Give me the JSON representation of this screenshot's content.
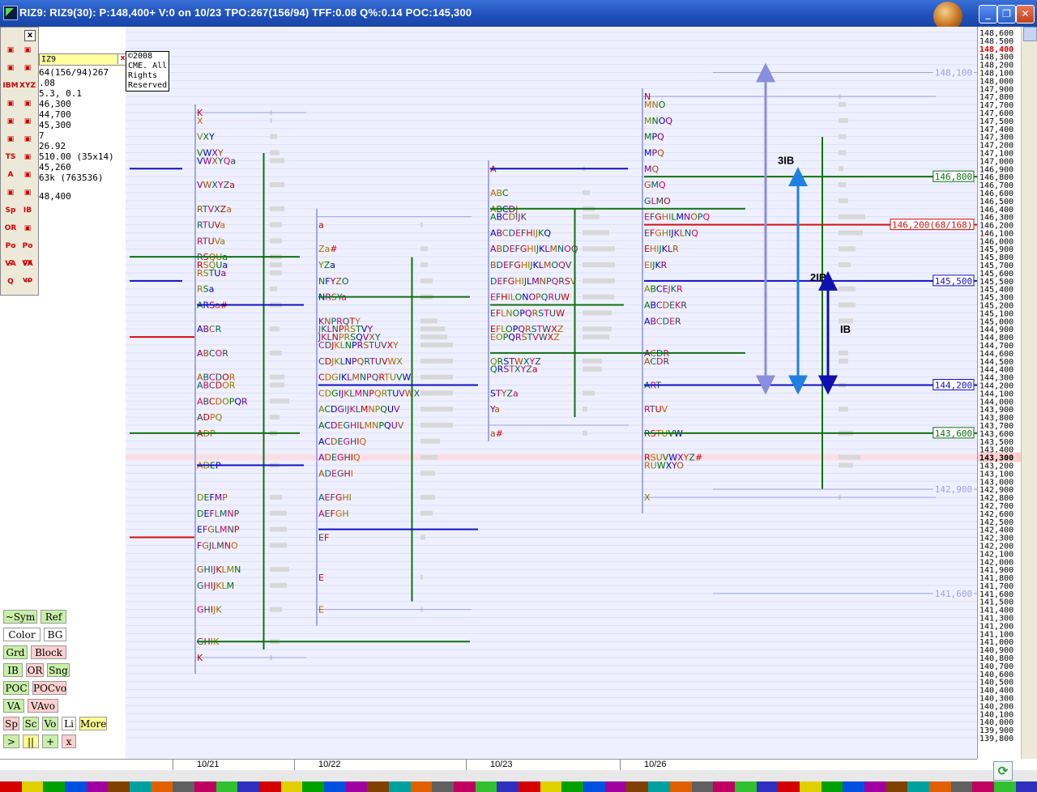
{
  "window": {
    "title": "RIZ9: RIZ9(30): P:148,400+ V:0 on 10/23 TPO:267(156/94) TFF:0.08 Q%:0.14 POC:145,300",
    "controls": {
      "minimize": "_",
      "restore": "❐",
      "close": "✕"
    }
  },
  "copyright": "©2008 CME. All Rights Reserved",
  "symbol": {
    "name": "IZ9",
    "close": "x"
  },
  "info_rows": [
    "64(156/94)267",
    ".08",
    "5.3, 0.1",
    "46,300",
    "44,700",
    "45,300",
    "7",
    "26.92",
    "510.00 (35x14)",
    "45,260",
    "63k (763536)",
    "48,400"
  ],
  "tools": [
    {
      "icon": "pencil-edit-icon",
      "label": ""
    },
    {
      "icon": "chart-edit-icon",
      "label": ""
    },
    {
      "icon": "hand-icon",
      "label": ""
    },
    {
      "icon": "refresh-icon",
      "label": ""
    },
    {
      "icon": "ibm-check-icon",
      "label": "IBM"
    },
    {
      "icon": "xyz-triangle-icon",
      "label": "XYZ"
    },
    {
      "icon": "camera-icon",
      "label": ""
    },
    {
      "icon": "calculator-icon",
      "label": ""
    },
    {
      "icon": "color-wheel-icon",
      "label": ""
    },
    {
      "icon": "color-wheel-2-icon",
      "label": ""
    },
    {
      "icon": "grid-icon",
      "label": ""
    },
    {
      "icon": "play-icon",
      "label": ""
    },
    {
      "icon": "ts-icon",
      "label": "TS"
    },
    {
      "icon": "line-icon",
      "label": ""
    },
    {
      "icon": "text-a-icon",
      "label": "A"
    },
    {
      "icon": "text-lines-icon",
      "label": ""
    },
    {
      "icon": "ruler-icon",
      "label": ""
    },
    {
      "icon": "scale-icon",
      "label": ""
    },
    {
      "icon": "sp-icon",
      "label": "Sp"
    },
    {
      "icon": "ib-icon",
      "label": "IB"
    },
    {
      "icon": "or-icon",
      "label": "OR"
    },
    {
      "icon": "diamond-icon",
      "label": ""
    },
    {
      "icon": "poc-icon",
      "label": "Po c"
    },
    {
      "icon": "pocv-icon",
      "label": "Po cv"
    },
    {
      "icon": "va-icon",
      "label": "VA"
    },
    {
      "icon": "vavo-icon",
      "label": "VA vo"
    },
    {
      "icon": "zoom-icon",
      "label": "Q"
    },
    {
      "icon": "move-arrows-icon",
      "label": "↔"
    }
  ],
  "buttons": [
    {
      "label": "~Sym",
      "color": "#c8f0a8"
    },
    {
      "label": "Ref",
      "color": "#c8f0a8"
    },
    {
      "label": "Color",
      "color": "#ffffff"
    },
    {
      "label": "BG",
      "color": "#ffffff"
    },
    {
      "label": "Grd",
      "color": "#c8f0a8"
    },
    {
      "label": "Block",
      "color": "#ffd0d0"
    },
    {
      "label": "IB",
      "color": "#c8f0a8"
    },
    {
      "label": "OR",
      "color": "#ffd0d0"
    },
    {
      "label": "Sng",
      "color": "#c8f0a8"
    },
    {
      "label": "POC",
      "color": "#c8f0a8"
    },
    {
      "label": "POCvo",
      "color": "#ffd0d0"
    },
    {
      "label": "VA",
      "color": "#c8f0a8"
    },
    {
      "label": "VAvo",
      "color": "#ffd0d0"
    },
    {
      "label": "Sp",
      "color": "#ffd0d0"
    },
    {
      "label": "Sc",
      "color": "#c8f0a8"
    },
    {
      "label": "Vo",
      "color": "#c8f0a8"
    },
    {
      "label": "Li",
      "color": "#ffffff"
    },
    {
      "label": "More",
      "color": "#ffff90"
    },
    {
      "label": ">",
      "color": "#c8f0a8"
    },
    {
      "label": "||",
      "color": "#ffff90"
    },
    {
      "label": "+",
      "color": "#c8f0a8"
    },
    {
      "label": "x",
      "color": "#ffd0d0"
    }
  ],
  "chart_data": {
    "type": "market_profile",
    "y_axis": {
      "min": 139800,
      "max": 148600,
      "step": 100,
      "label_values": [
        139800,
        139900,
        140000,
        140100,
        140200,
        140300,
        140400,
        140500,
        140600,
        140700,
        140800,
        140900,
        141000,
        141100,
        141200,
        141300,
        141400,
        141500,
        141600,
        141700,
        141800,
        141900,
        142000,
        142100,
        142200,
        142300,
        142400,
        142500,
        142600,
        142700,
        142800,
        142900,
        143000,
        143100,
        143200,
        143300,
        143400,
        143500,
        143600,
        143700,
        143800,
        143900,
        144000,
        144100,
        144200,
        144300,
        144400,
        144500,
        144600,
        144700,
        144800,
        144900,
        145000,
        145100,
        145200,
        145300,
        145400,
        145500,
        145600,
        145700,
        145800,
        145900,
        146000,
        146100,
        146200,
        146300,
        146400,
        146500,
        146600,
        146700,
        146800,
        146900,
        147000,
        147100,
        147200,
        147300,
        147400,
        147500,
        147600,
        147700,
        147800,
        147900,
        148000,
        148100,
        148200,
        148300,
        148400,
        148500,
        148600
      ]
    },
    "current_price": 148400,
    "highlight_price": 143300,
    "highlight_price_label": "143,300",
    "current_price_label": "148,400",
    "dates": [
      "10/21",
      "10/22",
      "10/23",
      "10/26"
    ],
    "sessions": [
      {
        "date": "10/21",
        "high": 147600,
        "low": 140800,
        "rows": [
          [
            "K",
            147600
          ],
          [
            "X",
            147500
          ],
          [
            "VXY",
            147300
          ],
          [
            "VWXY",
            147100
          ],
          [
            "VWXYQa",
            147000
          ],
          [
            "VWXYZa",
            146700
          ],
          [
            "RTVXZa",
            146400
          ],
          [
            "RTUVa",
            146200
          ],
          [
            "RTUVa",
            146000
          ],
          [
            "RSQUa",
            145800
          ],
          [
            "RSQUa",
            145700
          ],
          [
            "RSTUa",
            145600
          ],
          [
            "RSa",
            145400
          ],
          [
            "ARSa#",
            145200
          ],
          [
            "ABCR",
            144900
          ],
          [
            "ABCOR",
            144600
          ],
          [
            "ABCDOR",
            144300
          ],
          [
            "ABCDOR",
            144200
          ],
          [
            "ABCDOPQR",
            144000
          ],
          [
            "ADPQ",
            143800
          ],
          [
            "ADP",
            143600
          ],
          [
            "ADEP",
            143200
          ],
          [
            "DEFMP",
            142800
          ],
          [
            "DEFLMNP",
            142600
          ],
          [
            "EFGLMNP",
            142400
          ],
          [
            "FGJLMNO",
            142200
          ],
          [
            "GHIJKLMN",
            141900
          ],
          [
            "GHIJKLM",
            141700
          ],
          [
            "GHIJK",
            141400
          ],
          [
            "GHIK",
            141000
          ],
          [
            "K",
            140800
          ]
        ]
      },
      {
        "date": "10/22",
        "high": 146300,
        "low": 141400,
        "rows": [
          [
            "a",
            146200
          ],
          [
            "Za#",
            145900
          ],
          [
            "YZa",
            145700
          ],
          [
            "NFYZO",
            145500
          ],
          [
            "NRSYa",
            145300
          ],
          [
            "KNPRQTY",
            145000
          ],
          [
            "JKLNPRSTVY",
            144900
          ],
          [
            "JKLNPRSQVXY",
            144800
          ],
          [
            "CDJKLNPRSTUVXY",
            144700
          ],
          [
            "CDJKLNPQRTUVWX",
            144500
          ],
          [
            "CDGIKLMNPQRTUVW",
            144300
          ],
          [
            "CDGIJKLMNPQRTUVWX",
            144100
          ],
          [
            "ACDGIJKLMNPQUV",
            143900
          ],
          [
            "ACDEGHILMNPQUV",
            143700
          ],
          [
            "ACDEGHIQ",
            143500
          ],
          [
            "ADEGHIQ",
            143300
          ],
          [
            "ADEGHI",
            143100
          ],
          [
            "AEFGHI",
            142800
          ],
          [
            "AEFGH",
            142600
          ],
          [
            "EF",
            142300
          ],
          [
            "E",
            141800
          ],
          [
            "E",
            141400
          ]
        ]
      },
      {
        "date": "10/23",
        "high": 146900,
        "low": 143700,
        "rows": [
          [
            "A",
            146900
          ],
          [
            "ABC",
            146600
          ],
          [
            "ABCDJ",
            146400
          ],
          [
            "ABCDIJK",
            146300
          ],
          [
            "ABCDEFHIJKQ",
            146100
          ],
          [
            "ABDEFGHIJKLMNOQ",
            145900
          ],
          [
            "BDEFGHIJKLMOQV",
            145700
          ],
          [
            "DEFGHIJLMNPQRSV",
            145500
          ],
          [
            "EFHILONOPQRUW",
            145300
          ],
          [
            "EFLNOPQRSTUW",
            145100
          ],
          [
            "EFLOPQRSTWXZ",
            144900
          ],
          [
            "EOPQRSTVWXZ",
            144800
          ],
          [
            "QRSTWXYZ",
            144500
          ],
          [
            "QRSTXYZa",
            144400
          ],
          [
            "STYZa",
            144100
          ],
          [
            "Ya",
            143900
          ],
          [
            "a#",
            143600
          ]
        ]
      },
      {
        "date": "10/26",
        "high": 147800,
        "low": 142800,
        "rows": [
          [
            "N",
            147800
          ],
          [
            "MNO",
            147700
          ],
          [
            "MNOQ",
            147500
          ],
          [
            "MPQ",
            147300
          ],
          [
            "MPQ",
            147100
          ],
          [
            "MQ",
            146900
          ],
          [
            "GMQ",
            146700
          ],
          [
            "GLMO",
            146500
          ],
          [
            "EFGHILMNOPQ",
            146300
          ],
          [
            "EFGHIJKLNQ",
            146100
          ],
          [
            "EHIJKLR",
            145900
          ],
          [
            "EIJKR",
            145700
          ],
          [
            "ABCEJKR",
            145400
          ],
          [
            "ABCDEKR",
            145200
          ],
          [
            "ABCDER",
            145000
          ],
          [
            "ACDR",
            144600
          ],
          [
            "ACDR",
            144500
          ],
          [
            "ART",
            144200
          ],
          [
            "RTUV",
            143900
          ],
          [
            "RSTUVW",
            143600
          ],
          [
            "RSUVWXYZ#",
            143300
          ],
          [
            "RUWXYO",
            143200
          ],
          [
            "X",
            142800
          ]
        ]
      }
    ],
    "reference_lines": [
      {
        "label": "146,800",
        "price": 146800,
        "color": "#107010",
        "style": "green"
      },
      {
        "label": "146,200(68/168)",
        "price": 146200,
        "color": "#d01010",
        "style": "red"
      },
      {
        "label": "145,500",
        "price": 145500,
        "color": "#1010c0",
        "style": "blue"
      },
      {
        "label": "144,200",
        "price": 144200,
        "color": "#1010c0",
        "style": "blue"
      },
      {
        "label": "143,600",
        "price": 143600,
        "color": "#107010",
        "style": "green"
      },
      {
        "label": "148,100",
        "price": 148100,
        "color": "#a0a0e0",
        "style": "faint"
      },
      {
        "label": "142,900",
        "price": 142900,
        "color": "#a0a0e0",
        "style": "faint"
      },
      {
        "label": "141,600",
        "price": 141600,
        "color": "#a0a0e0",
        "style": "faint"
      }
    ],
    "annotations": [
      {
        "label": "3IB",
        "from": 144200,
        "to": 148100,
        "color": "#8a8ee0"
      },
      {
        "label": "2IB",
        "from": 144200,
        "to": 146800,
        "color": "#2080e0"
      },
      {
        "label": "IB",
        "from": 144200,
        "to": 145500,
        "color": "#1010b0"
      }
    ]
  },
  "colorbar": [
    "#d40000",
    "#e0d000",
    "#00a000",
    "#0050e0",
    "#a000a0",
    "#804000",
    "#00a0a0",
    "#e06000",
    "#606060",
    "#c00060",
    "#30c030",
    "#3030c0"
  ]
}
